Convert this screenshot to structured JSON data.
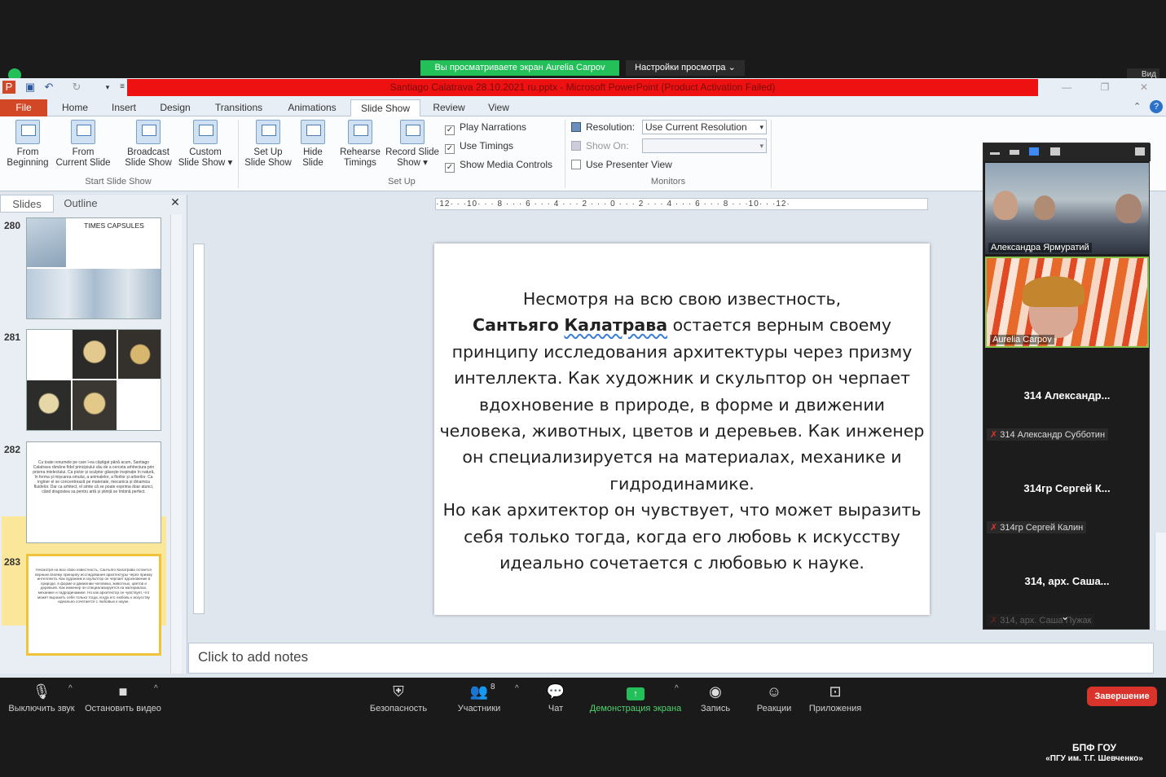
{
  "zoom": {
    "share_banner": "Вы просматриваете экран Aurelia Carpov",
    "view_options": "Настройки просмотра ⌄",
    "view_button": "Вид",
    "toolbar": {
      "mute": "Выключить звук",
      "stop_video": "Остановить видео",
      "security": "Безопасность",
      "participants": "Участники",
      "participants_count": "8",
      "chat": "Чат",
      "share_screen": "Демонстрация экрана",
      "record": "Запись",
      "reactions": "Реакции",
      "apps": "Приложения",
      "end": "Завершение"
    },
    "participants": [
      {
        "name": "Александра Ярмуратий"
      },
      {
        "name": "Aurelia Carpov"
      },
      {
        "big": "314 Александр...",
        "small": "314 Александр Субботин"
      },
      {
        "big": "314гр Сергей К...",
        "small": "314гр Сергей Калин"
      },
      {
        "big": "314, арх. Саша...",
        "small": "314, арх. Саша Пужак"
      }
    ],
    "watermark_line1": "БПФ ГОУ",
    "watermark_line2": "«ПГУ им. Т.Г. Шевченко»"
  },
  "ppt": {
    "title": "Santiago Calatrava 28.10.2021 ru.pptx  -  Microsoft PowerPoint (Product Activation Failed)",
    "tabs": [
      "File",
      "Home",
      "Insert",
      "Design",
      "Transitions",
      "Animations",
      "Slide Show",
      "Review",
      "View"
    ],
    "ribbon": {
      "from_beginning": [
        "From",
        "Beginning"
      ],
      "from_current": [
        "From",
        "Current Slide"
      ],
      "broadcast": [
        "Broadcast",
        "Slide Show"
      ],
      "custom": [
        "Custom",
        "Slide Show ▾"
      ],
      "group_start": "Start Slide Show",
      "setup": [
        "Set Up",
        "Slide Show"
      ],
      "hide": [
        "Hide",
        "Slide"
      ],
      "rehearse": [
        "Rehearse",
        "Timings"
      ],
      "record": [
        "Record Slide",
        "Show ▾"
      ],
      "play_narrations": "Play Narrations",
      "use_timings": "Use Timings",
      "show_media": "Show Media Controls",
      "group_setup": "Set Up",
      "resolution_label": "Resolution:",
      "resolution_value": "Use Current Resolution",
      "show_on_label": "Show On:",
      "presenter_view": "Use Presenter View",
      "group_monitors": "Monitors"
    },
    "pane": {
      "tab_slides": "Slides",
      "tab_outline": "Outline",
      "thumbs": [
        {
          "num": "280",
          "title": "TIMES CAPSULES"
        },
        {
          "num": "281"
        },
        {
          "num": "282",
          "text": "Cu toate renumele pe care l-ea câștigat până acum, Santiago Calatrava rămâne fidel principiului său de a cerceta arhitectura prin prisma intelectului. Ca pictor și sculptor găsește inspirație în natură, în forma și mișcarea omului, a animalelor, a florilor și arborilor. Ca inginer el se concentrează pe materiale, mecanica și dinamica fluidelor. Dar ca arhitect, el simte că se poate exprima doar atunci, când dragostea sa pentru artă și știință se îmbină perfect."
        },
        {
          "num": "283",
          "text": "Несмотря на всю свою известность, Сантьяго Калатрава остается верным своему принципу исследования архитектуры через призму интеллекта. Как художник и скульптор он черпает вдохновение в природе, в форме и движении человека, животных, цветов и деревьев. Как инженер он специализируется на материалах, механике и гидродинамике. Но как архитектор он чувствует, что может выразить себя только тогда, когда его любовь к искусству идеально сочетается с любовью к науке."
        }
      ]
    },
    "ruler": "·12· · ·10· · · 8 · · · 6 · · · 4 · · · 2 · · · 0 · · · 2 · · · 4 · · · 6 · · · 8 · · ·10· · ·12·",
    "slide": {
      "line1": "Несмотря на всю свою известность,",
      "bold": "Сантьяго",
      "bold_underlined": "Калатрава",
      "line2_rest": " остается верным своему",
      "rest": "принципу исследования архитектуры через призму интеллекта. Как художник и скульптор он черпает вдохновение в природе, в форме и движении человека, животных, цветов и деревьев. Как инженер он специализируется на материалах, механике и гидродинамике.",
      "para2": "Но как архитектор он чувствует, что может выразить себя только тогда, когда его любовь к искусству идеально сочетается с любовью к науке."
    },
    "notes_placeholder": "Click to add notes"
  }
}
